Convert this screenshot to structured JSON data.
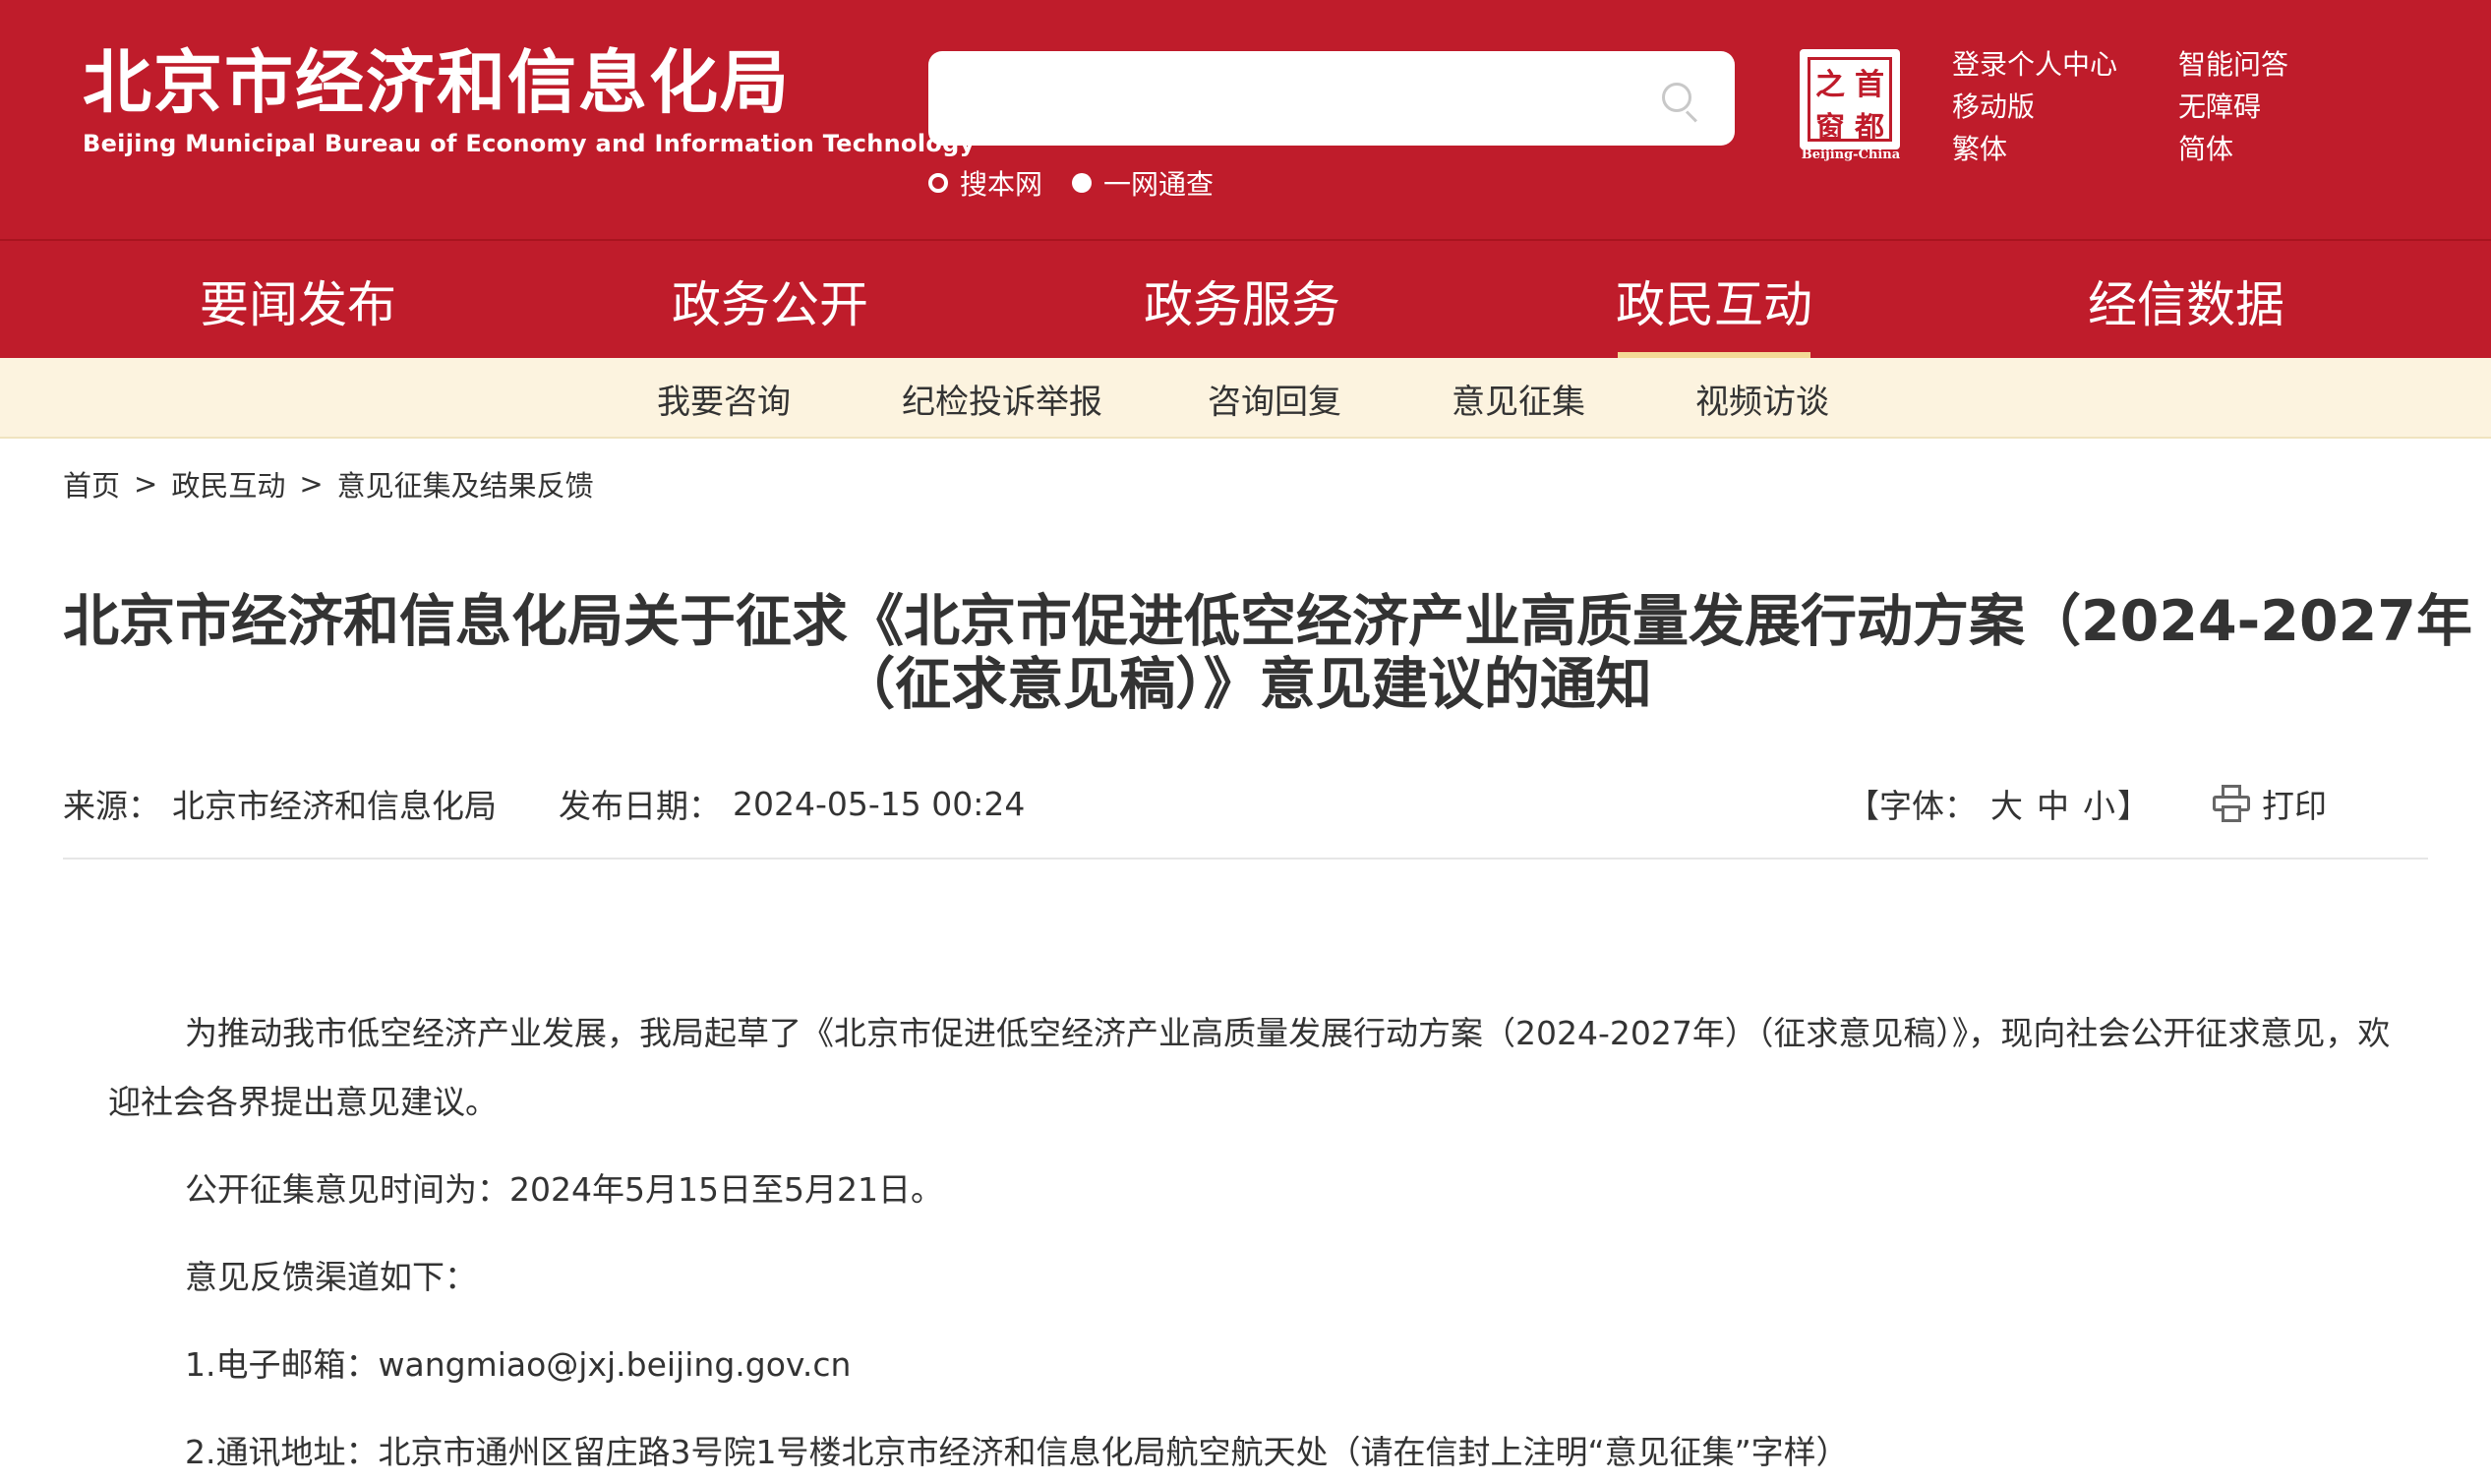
{
  "header": {
    "logo_cn": "北京市经济和信息化局",
    "logo_en": "Beijing Municipal Bureau of Economy and Information Technology",
    "search": {
      "value": "",
      "placeholder": ""
    },
    "search_options": [
      "搜本网",
      "一网通查"
    ],
    "seal_chars": [
      "之",
      "首",
      "窗",
      "都"
    ],
    "seal_text": "Beijing-China",
    "util_links": [
      "登录个人中心",
      "智能问答",
      "移动版",
      "无障碍",
      "繁体",
      "简体"
    ]
  },
  "nav": {
    "items": [
      "要闻发布",
      "政务公开",
      "政务服务",
      "政民互动",
      "经信数据"
    ],
    "active_index": 3
  },
  "subnav": {
    "items": [
      "我要咨询",
      "纪检投诉举报",
      "咨询回复",
      "意见征集",
      "视频访谈"
    ]
  },
  "breadcrumb": {
    "items": [
      "首页",
      "政民互动",
      "意见征集及结果反馈"
    ],
    "separator": ">"
  },
  "article": {
    "title_line1": "北京市经济和信息化局关于征求《北京市促进低空经济产业高质量发展行动方案（2024-2027年",
    "title_line2": "（征求意见稿）》意见建议的通知",
    "source_label": "来源：",
    "source": "北京市经济和信息化局",
    "date_label": "发布日期：",
    "date": "2024-05-15 00:24",
    "font_size_label": "【字体：",
    "font_sizes": [
      "大",
      "中",
      "小"
    ],
    "font_size_close": "】",
    "print_label": "打印",
    "paragraphs": [
      "为推动我市低空经济产业发展，我局起草了《北京市促进低空经济产业高质量发展行动方案（2024-2027年）（征求意见稿）》，现向社会公开征求意见，欢",
      "迎社会各界提出意见建议。",
      "公开征集意见时间为：2024年5月15日至5月21日。",
      "意见反馈渠道如下：",
      "1.电子邮箱：wangmiao@jxj.beijing.gov.cn",
      "2.通讯地址：北京市通州区留庄路3号院1号楼北京市经济和信息化局航空航天处（请在信封上注明“意见征集”字样）"
    ]
  },
  "colors": {
    "brand_red": "#bf1c2b",
    "subnav_bg": "#fcf3df",
    "active_underline": "#f3d996"
  }
}
